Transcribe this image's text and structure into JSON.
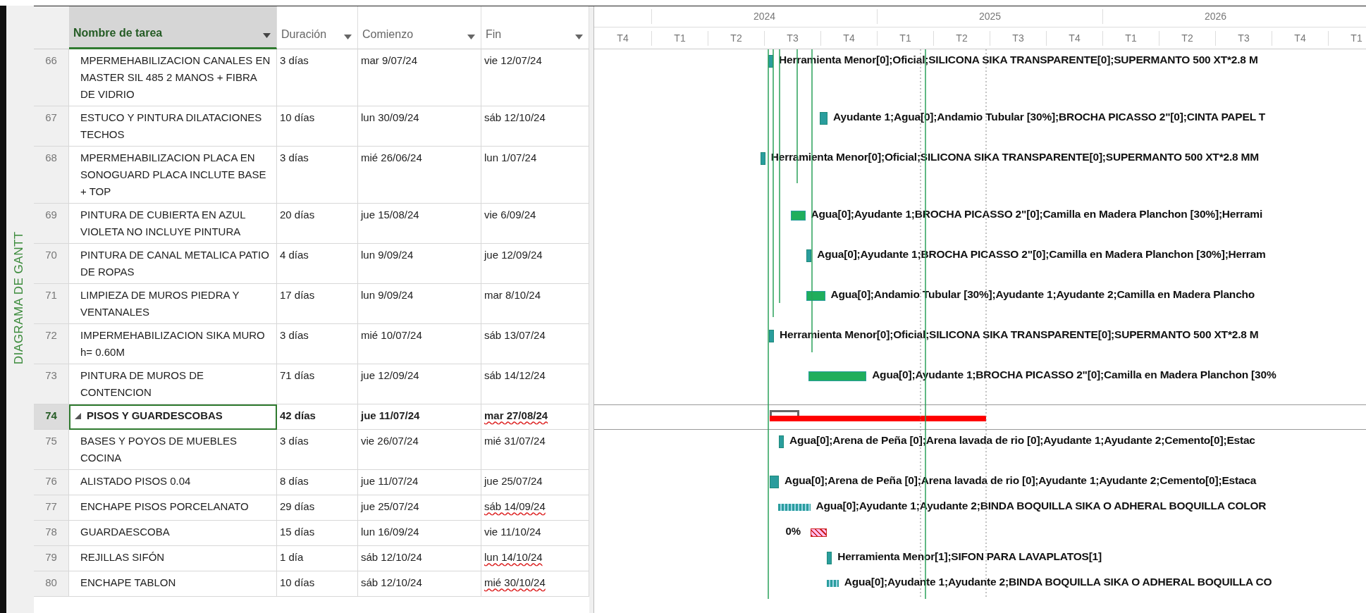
{
  "side_label": "DIAGRAMA DE GANTT",
  "columns": [
    {
      "label": "Nombre de tarea",
      "selected": true
    },
    {
      "label": "Duración",
      "selected": false
    },
    {
      "label": "Comienzo",
      "selected": false
    },
    {
      "label": "Fin",
      "selected": false
    }
  ],
  "timeline": {
    "years": [
      "2024",
      "2025",
      "2026"
    ],
    "quarters": [
      "T4",
      "T1",
      "T2",
      "T3",
      "T4",
      "T1",
      "T2",
      "T3",
      "T4",
      "T1",
      "T2",
      "T3",
      "T4",
      "T1"
    ]
  },
  "tasks": [
    {
      "id": "66",
      "kind": "task",
      "selected": false,
      "name": "MPERMEHABILIZACION CANALES EN MASTER SIL 485 2 MANOS + FIBRA DE VIDRIO",
      "duration": "3 días",
      "start": "mar 9/07/24",
      "finish": "vie 12/07/24",
      "finish_flagged": false,
      "bar": {
        "kind": "normal",
        "label": "Herramienta Menor[0];Oficial;SILICONA SIKA TRANSPARENTE[0];SUPERMANTO 500 XT*2.8 M"
      }
    },
    {
      "id": "67",
      "kind": "task",
      "selected": false,
      "name": "ESTUCO Y PINTURA DILATACIONES TECHOS",
      "duration": "10 días",
      "start": "lun 30/09/24",
      "finish": "sáb 12/10/24",
      "finish_flagged": false,
      "bar": {
        "kind": "normal",
        "label": "Ayudante 1;Agua[0];Andamio Tubular [30%];BROCHA PICASSO 2\"[0];CINTA PAPEL T"
      }
    },
    {
      "id": "68",
      "kind": "task",
      "selected": false,
      "name": "MPERMEHABILIZACION PLACA EN SONOGUARD PLACA INCLUTE BASE + TOP",
      "duration": "3 días",
      "start": "mié 26/06/24",
      "finish": "lun 1/07/24",
      "finish_flagged": false,
      "bar": {
        "kind": "normal",
        "label": "Herramienta Menor[0];Oficial;SILICONA SIKA TRANSPARENTE[0];SUPERMANTO 500 XT*2.8 MM"
      }
    },
    {
      "id": "69",
      "kind": "task",
      "selected": false,
      "name": "PINTURA DE CUBIERTA EN AZUL VIOLETA NO INCLUYE PINTURA",
      "duration": "20 días",
      "start": "jue 15/08/24",
      "finish": "vie 6/09/24",
      "finish_flagged": false,
      "bar": {
        "kind": "critical",
        "label": "Agua[0];Ayudante 1;BROCHA PICASSO 2\"[0];Camilla en Madera Planchon [30%];Herrami"
      }
    },
    {
      "id": "70",
      "kind": "task",
      "selected": false,
      "name": "PINTURA DE CANAL METALICA PATIO DE ROPAS",
      "duration": "4 días",
      "start": "lun 9/09/24",
      "finish": "jue 12/09/24",
      "finish_flagged": false,
      "bar": {
        "kind": "normal",
        "label": "Agua[0];Ayudante 1;BROCHA PICASSO 2\"[0];Camilla en Madera Planchon [30%];Herram"
      }
    },
    {
      "id": "71",
      "kind": "task",
      "selected": false,
      "name": "LIMPIEZA DE MUROS PIEDRA Y VENTANALES",
      "duration": "17 días",
      "start": "lun 9/09/24",
      "finish": "mar 8/10/24",
      "finish_flagged": false,
      "bar": {
        "kind": "critical",
        "label": "Agua[0];Andamio Tubular [30%];Ayudante 1;Ayudante 2;Camilla en Madera Plancho"
      }
    },
    {
      "id": "72",
      "kind": "task",
      "selected": false,
      "name": "IMPERMEHABILIZACION SIKA MURO h= 0.60M",
      "duration": "3 días",
      "start": "mié 10/07/24",
      "finish": "sáb 13/07/24",
      "finish_flagged": false,
      "bar": {
        "kind": "normal",
        "label": "Herramienta Menor[0];Oficial;SILICONA SIKA TRANSPARENTE[0];SUPERMANTO 500 XT*2.8 M"
      }
    },
    {
      "id": "73",
      "kind": "task",
      "selected": false,
      "name": "PINTURA DE MUROS DE CONTENCION",
      "duration": "71 días",
      "start": "jue 12/09/24",
      "finish": "sáb 14/12/24",
      "finish_flagged": false,
      "bar": {
        "kind": "critical",
        "label": "Agua[0];Ayudante 1;BROCHA PICASSO 2\"[0];Camilla en Madera Planchon [30%"
      }
    },
    {
      "id": "74",
      "kind": "summary",
      "selected": true,
      "name": "PISOS Y GUARDESCOBAS",
      "duration": "42 días",
      "start": "jue 11/07/24",
      "finish": "mar 27/08/24",
      "finish_flagged": true,
      "bar": {
        "kind": "summary"
      }
    },
    {
      "id": "75",
      "kind": "task",
      "selected": false,
      "name": "BASES Y POYOS DE MUEBLES COCINA",
      "duration": "3 días",
      "start": "vie 26/07/24",
      "finish": "mié 31/07/24",
      "finish_flagged": false,
      "bar": {
        "kind": "normal",
        "label": "Agua[0];Arena de Peña [0];Arena lavada de rio [0];Ayudante 1;Ayudante 2;Cemento[0];Estac"
      }
    },
    {
      "id": "76",
      "kind": "task",
      "selected": false,
      "name": "ALISTADO PISOS 0.04",
      "duration": "8 días",
      "start": "jue 11/07/24",
      "finish": "jue 25/07/24",
      "finish_flagged": false,
      "bar": {
        "kind": "normal",
        "label": "Agua[0];Arena de Peña [0];Arena lavada de rio [0];Ayudante 1;Ayudante 2;Cemento[0];Estaca"
      }
    },
    {
      "id": "77",
      "kind": "task",
      "selected": false,
      "name": "ENCHAPE PISOS PORCELANATO",
      "duration": "29 días",
      "start": "jue 25/07/24",
      "finish": "sáb 14/09/24",
      "finish_flagged": true,
      "bar": {
        "kind": "split",
        "label": "Agua[0];Ayudante 1;Ayudante 2;BINDA BOQUILLA SIKA O ADHERAL BOQUILLA COLOR"
      }
    },
    {
      "id": "78",
      "kind": "task",
      "selected": false,
      "name": "GUARDAESCOBA",
      "duration": "15 días",
      "start": "lun 16/09/24",
      "finish": "vie 11/10/24",
      "finish_flagged": false,
      "bar": {
        "kind": "late",
        "progress": "0%"
      }
    },
    {
      "id": "79",
      "kind": "task",
      "selected": false,
      "name": "REJILLAS SIFÓN",
      "duration": "1 día",
      "start": "sáb 12/10/24",
      "finish": "lun 14/10/24",
      "finish_flagged": true,
      "bar": {
        "kind": "normal",
        "label": "Herramienta Menor[1];SIFON PARA LAVAPLATOS[1]"
      }
    },
    {
      "id": "80",
      "kind": "task",
      "selected": false,
      "name": "ENCHAPE TABLON",
      "duration": "10 días",
      "start": "sáb 12/10/24",
      "finish": "mié 30/10/24",
      "finish_flagged": true,
      "bar": {
        "kind": "split",
        "label": "Agua[0];Ayudante 1;Ayudante 2;BINDA BOQUILLA SIKA O ADHERAL BOQUILLA CO"
      }
    }
  ]
}
